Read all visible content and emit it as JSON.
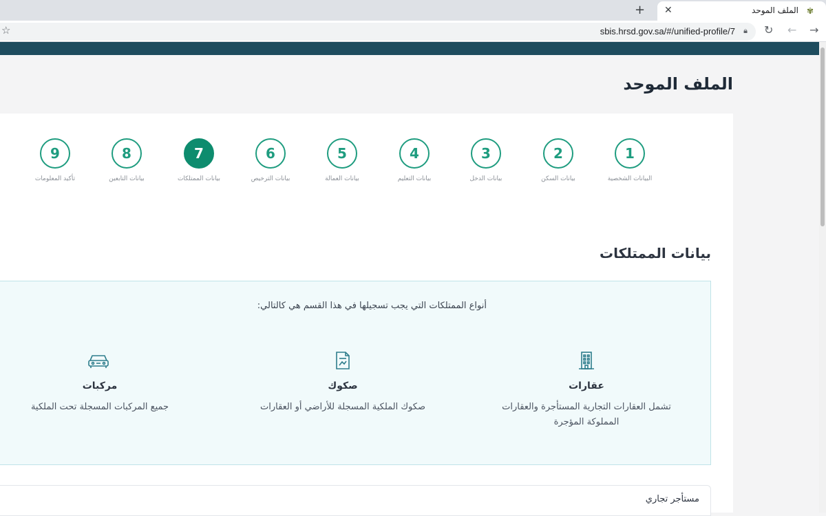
{
  "browser": {
    "tab_title": "الملف الموحد",
    "url": "sbis.hrsd.gov.sa/#/unified-profile/7"
  },
  "page": {
    "title": "الملف الموحد"
  },
  "stepper": {
    "active_step": "7",
    "steps": [
      {
        "number": "1",
        "label": "البيانات الشخصية"
      },
      {
        "number": "2",
        "label": "بيانات السكن"
      },
      {
        "number": "3",
        "label": "بيانات الدخل"
      },
      {
        "number": "4",
        "label": "بيانات التعليم"
      },
      {
        "number": "5",
        "label": "بيانات العمالة"
      },
      {
        "number": "6",
        "label": "بيانات الترخيص"
      },
      {
        "number": "7",
        "label": "بيانات الممتلكات"
      },
      {
        "number": "8",
        "label": "بيانات التابعين"
      },
      {
        "number": "9",
        "label": "تأكيد المعلومات"
      }
    ]
  },
  "section": {
    "title": "بيانات الممتلكات",
    "intro": "أنواع الممتلكات التي يجب تسجيلها في هذا القسم هي كالتالي:",
    "property_types": [
      {
        "name": "عقارات",
        "desc": "تشمل العقارات التجارية المستأجرة والعقارات المملوكة المؤجرة",
        "icon": "building-icon"
      },
      {
        "name": "صكوك",
        "desc": "صكوك الملكية المسجلة للأراضي أو العقارات",
        "icon": "deed-document-icon"
      },
      {
        "name": "مركبات",
        "desc": "جميع المركبات المسجلة تحت الملكية",
        "icon": "car-icon"
      }
    ],
    "tenant_label": "مستأجر تجاري"
  },
  "colors": {
    "accent": "#0e8c6e",
    "header": "#1e4c5e"
  }
}
